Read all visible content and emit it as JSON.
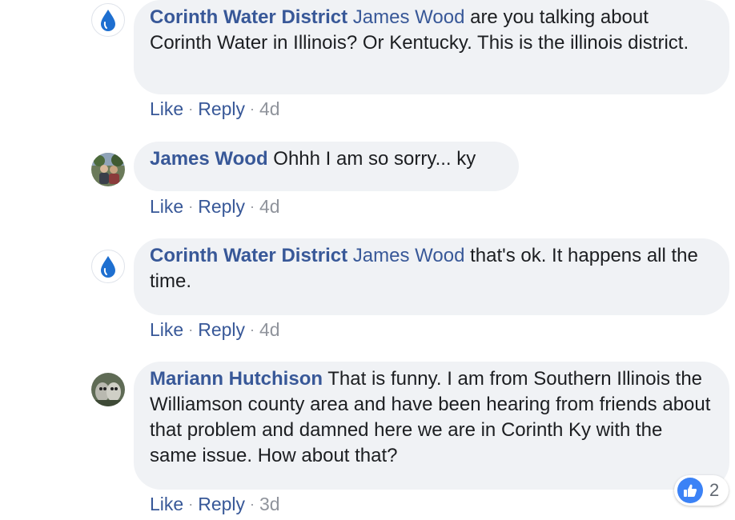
{
  "comments": [
    {
      "author": "Corinth Water District",
      "mention": "James Wood",
      "text": " are you talking about Corinth Water in Illinois? Or Kentucky. This is the illinois district.",
      "like": "Like",
      "reply": "Reply",
      "separator": "·",
      "time": "4d",
      "avatar": "water-drop-logo"
    },
    {
      "author": "James Wood",
      "mention": "",
      "text": " Ohhh I am so sorry... ky",
      "like": "Like",
      "reply": "Reply",
      "separator": "·",
      "time": "4d",
      "avatar": "profile-photo"
    },
    {
      "author": "Corinth Water District",
      "mention": "James Wood",
      "text": " that's ok. It happens all the time.",
      "like": "Like",
      "reply": "Reply",
      "separator": "·",
      "time": "4d",
      "avatar": "water-drop-logo"
    },
    {
      "author": "Mariann Hutchison",
      "mention": "",
      "text": " That is funny. I am from Southern Illinois the Williamson county area and have been hearing from friends about that problem and damned here we are in Corinth Ky with the same issue. How about that?",
      "like": "Like",
      "reply": "Reply",
      "separator": "·",
      "time": "3d",
      "avatar": "profile-photo",
      "reactions": {
        "icon": "thumbs-up-icon",
        "count": "2"
      }
    }
  ],
  "colors": {
    "link": "#385898",
    "bubble": "#f0f2f5",
    "muted": "#90949c",
    "like_badge": "#3b82f6"
  }
}
